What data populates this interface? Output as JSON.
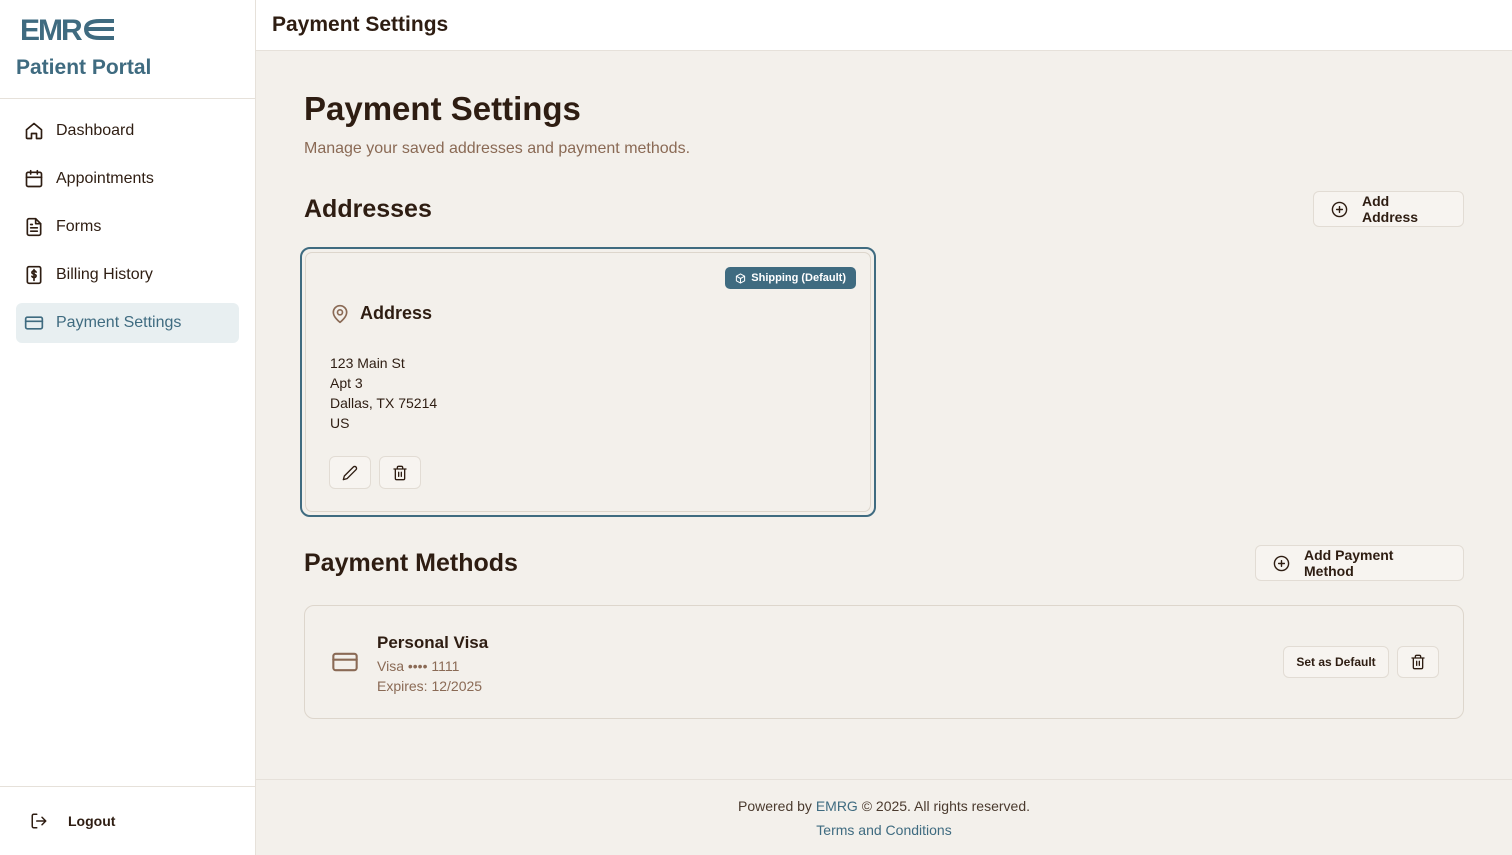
{
  "brand": {
    "logo_text": "EMRG",
    "portal_title": "Patient Portal"
  },
  "sidebar": {
    "items": [
      {
        "label": "Dashboard",
        "icon": "home-icon"
      },
      {
        "label": "Appointments",
        "icon": "calendar-icon"
      },
      {
        "label": "Forms",
        "icon": "document-icon"
      },
      {
        "label": "Billing History",
        "icon": "dollar-receipt-icon"
      },
      {
        "label": "Payment Settings",
        "icon": "credit-card-icon",
        "active": true
      }
    ],
    "logout_label": "Logout"
  },
  "topbar": {
    "title": "Payment Settings"
  },
  "main": {
    "title": "Payment Settings",
    "subtitle": "Manage your saved addresses and payment methods."
  },
  "addresses": {
    "section_title": "Addresses",
    "add_label": "Add Address",
    "card": {
      "badge": "Shipping (Default)",
      "title": "Address",
      "lines": [
        "123 Main St",
        "Apt 3",
        "Dallas, TX 75214",
        "US"
      ]
    }
  },
  "payment_methods": {
    "section_title": "Payment Methods",
    "add_label": "Add Payment Method",
    "card": {
      "name": "Personal Visa",
      "number": "Visa •••• 1111",
      "expires": "Expires: 12/2025",
      "set_default_label": "Set as Default"
    }
  },
  "footer": {
    "powered_prefix": "Powered by",
    "powered_link": "EMRG",
    "powered_suffix": "© 2025. All rights reserved.",
    "terms": "Terms and Conditions"
  },
  "colors": {
    "accent": "#3f6b80",
    "text": "#2e1d12",
    "muted": "#8a6a55",
    "background": "#f3f0eb"
  }
}
